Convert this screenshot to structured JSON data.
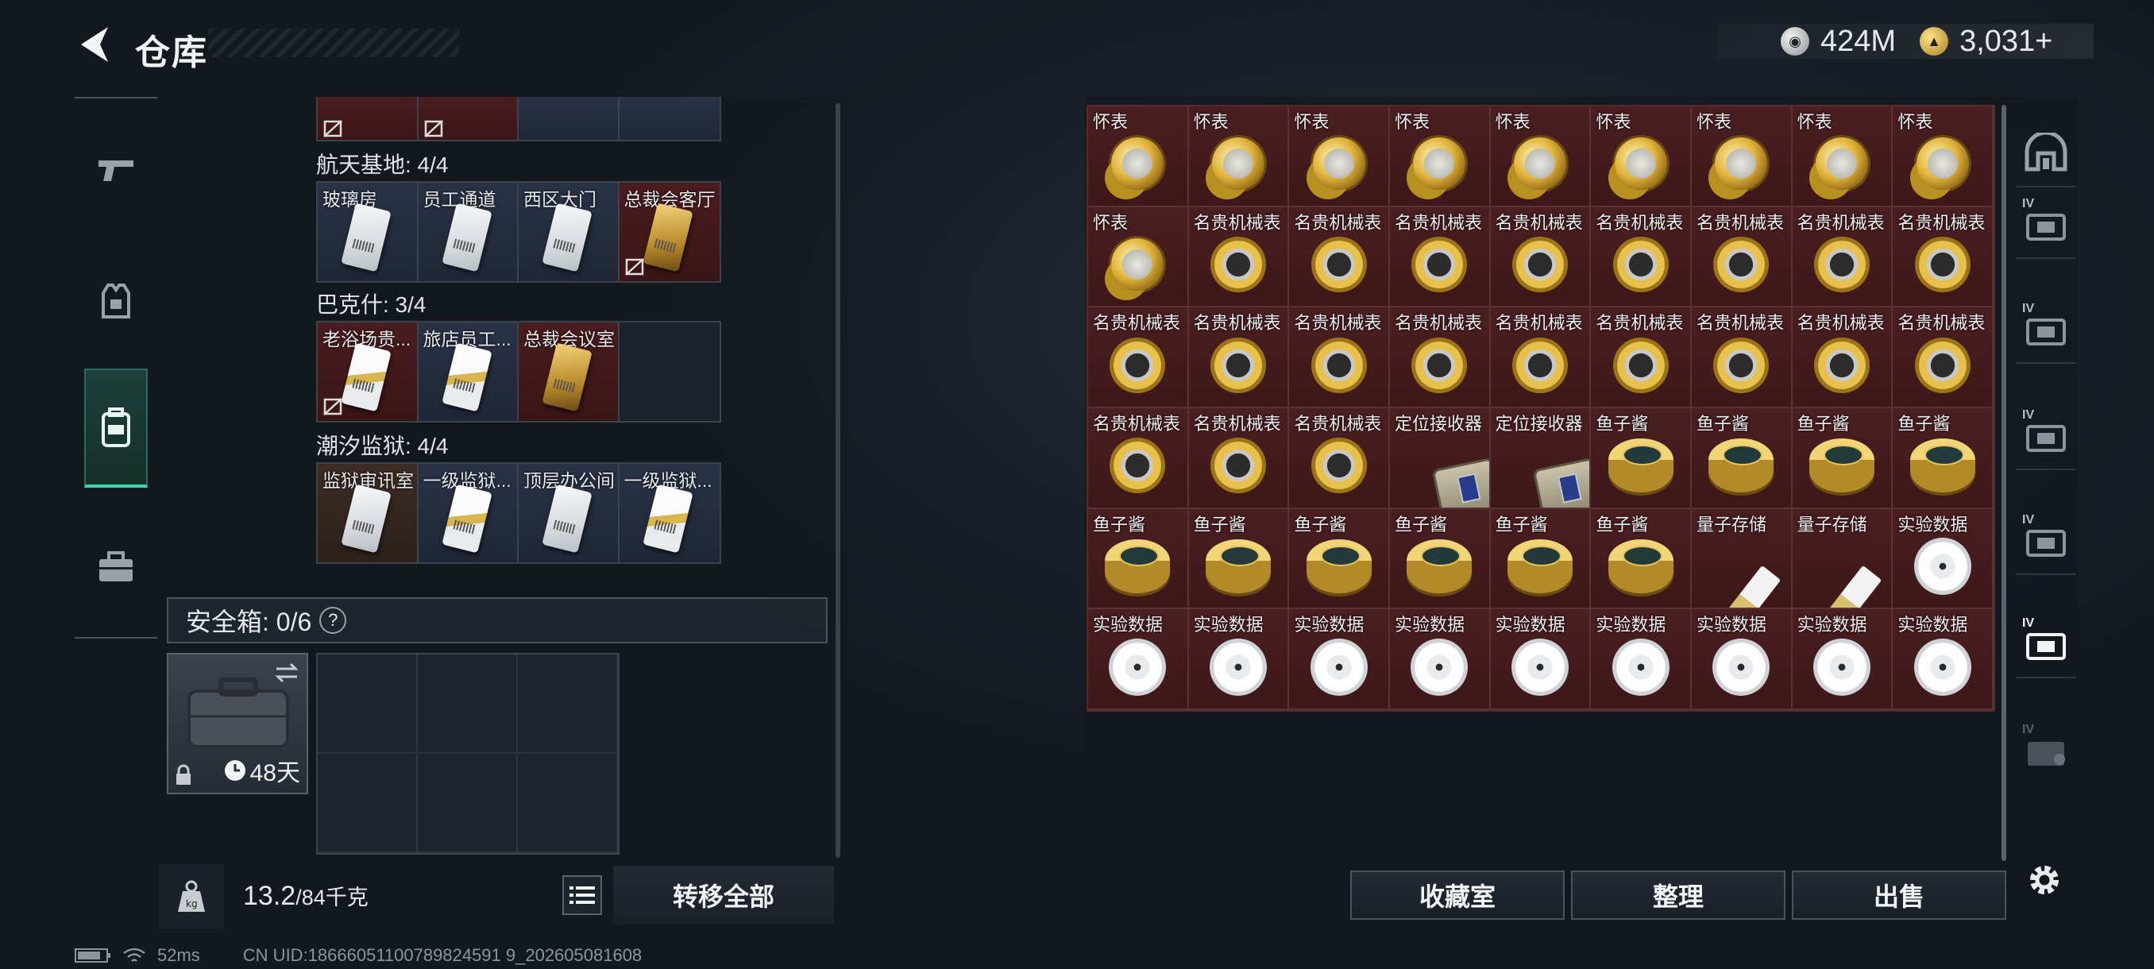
{
  "header": {
    "title": "仓库",
    "currency": [
      {
        "icon": "silver-coin-icon",
        "value": "424M"
      },
      {
        "icon": "gold-coin-icon",
        "value": "3,031+"
      }
    ]
  },
  "left_nav": [
    "weapon-tab",
    "armor-tab",
    "backpack-tab",
    "toolbox-tab"
  ],
  "key_sections": [
    {
      "label": "航天基地: 4/4",
      "cards": [
        "玻璃房",
        "员工通道",
        "西区大门",
        "总裁会客厅"
      ]
    },
    {
      "label": "巴克什: 3/4",
      "cards": [
        "老浴场贵...",
        "旅店员工...",
        "总裁会议室",
        ""
      ]
    },
    {
      "label": "潮汐监狱: 4/4",
      "cards": [
        "监狱审讯室",
        "一级监狱...",
        "顶层办公间",
        "一级监狱..."
      ]
    }
  ],
  "safe_box": {
    "label": "安全箱: 0/6",
    "help": "?",
    "days": "48天"
  },
  "weight": {
    "current": "13.2",
    "max": "/84千克"
  },
  "buttons": {
    "transfer_all": "转移全部",
    "collection": "收藏室",
    "organize": "整理",
    "sell": "出售"
  },
  "items": [
    "怀表",
    "怀表",
    "怀表",
    "怀表",
    "怀表",
    "怀表",
    "怀表",
    "怀表",
    "怀表",
    "怀表",
    "名贵机械表",
    "名贵机械表",
    "名贵机械表",
    "名贵机械表",
    "名贵机械表",
    "名贵机械表",
    "名贵机械表",
    "名贵机械表",
    "名贵机械表",
    "名贵机械表",
    "名贵机械表",
    "名贵机械表",
    "名贵机械表",
    "名贵机械表",
    "名贵机械表",
    "名贵机械表",
    "名贵机械表",
    "名贵机械表",
    "名贵机械表",
    "名贵机械表",
    "定位接收器",
    "定位接收器",
    "鱼子酱",
    "鱼子酱",
    "鱼子酱",
    "鱼子酱",
    "鱼子酱",
    "鱼子酱",
    "鱼子酱",
    "鱼子酱",
    "鱼子酱",
    "鱼子酱",
    "量子存储",
    "量子存储",
    "实验数据",
    "实验数据",
    "实验数据",
    "实验数据",
    "实验数据",
    "实验数据",
    "实验数据",
    "实验数据",
    "实验数据",
    "实验数据"
  ],
  "right_tabs": [
    "IV",
    "IV",
    "IV",
    "IV",
    "IV",
    "IV"
  ],
  "status": {
    "ping": "52ms",
    "uid": "CN UID:18666051100789824591 9_202605081608"
  }
}
